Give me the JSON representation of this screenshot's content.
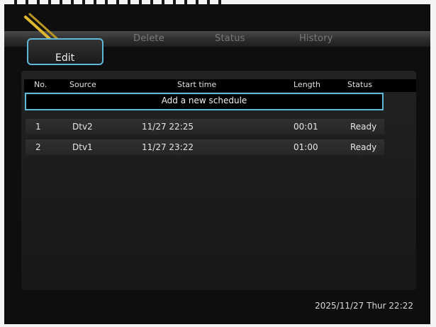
{
  "menu": {
    "tabs": [
      {
        "label": "Edit"
      },
      {
        "label": "Delete"
      },
      {
        "label": "Status"
      },
      {
        "label": "History"
      }
    ]
  },
  "table": {
    "headers": {
      "no": "No.",
      "source": "Source",
      "start_time": "Start time",
      "length": "Length",
      "status": "Status"
    },
    "add_row_label": "Add a new schedule",
    "rows": [
      {
        "no": "1",
        "source": "Dtv2",
        "start_time": "11/27 22:25",
        "length": "00:01",
        "status": "Ready"
      },
      {
        "no": "2",
        "source": "Dtv1",
        "start_time": "11/27 23:22",
        "length": "01:00",
        "status": "Ready"
      }
    ]
  },
  "footer": {
    "datetime": "2025/11/27 Thur 22:22"
  },
  "colors": {
    "accent": "#5fb8d8",
    "logo": "#e0b830"
  },
  "icons": {
    "logo": "pencil-logo-icon"
  }
}
